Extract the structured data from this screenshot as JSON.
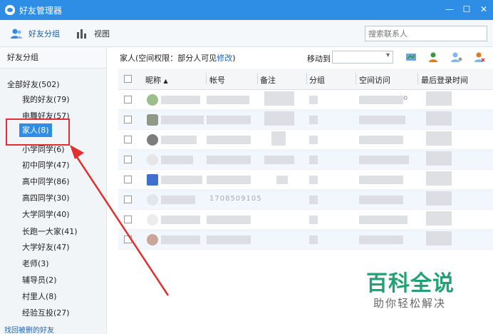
{
  "window": {
    "title": "好友管理器"
  },
  "toolbar": {
    "group_tab": "好友分组",
    "view_tab": "视图",
    "search_placeholder": "搜索联系人"
  },
  "sidebar": {
    "header": "好友分组",
    "root": "全部好友(502)",
    "groups": [
      "我的好友(79)",
      "电舞好友(57)",
      "家人(8)",
      "小学同学(6)",
      "初中同学(47)",
      "高中同学(86)",
      "高四同学(30)",
      "大学同学(40)",
      "长跑一大家(41)",
      "大学好友(47)",
      "老师(3)",
      "辅导员(2)",
      "村里人(8)",
      "经验互投(27)"
    ],
    "recover_link": "找回被删的好友"
  },
  "main": {
    "permission_prefix": "家人(空间权限：部分人可见",
    "permission_link": "修改",
    "permission_suffix": ")",
    "move_to_label": "移动到"
  },
  "table": {
    "columns": [
      "昵称",
      "帐号",
      "备注",
      "分组",
      "空间访问",
      "最后登录时间"
    ],
    "sort_indicator": "▲",
    "visible_fragments": {
      "row1_space": "o",
      "row6_account": "1708509105"
    }
  },
  "watermark": {
    "title": "百科全说",
    "subtitle": "助你轻松解决"
  },
  "colors": {
    "accent": "#2e8ee6",
    "highlight": "#e03030",
    "watermark": "#1fa374"
  }
}
